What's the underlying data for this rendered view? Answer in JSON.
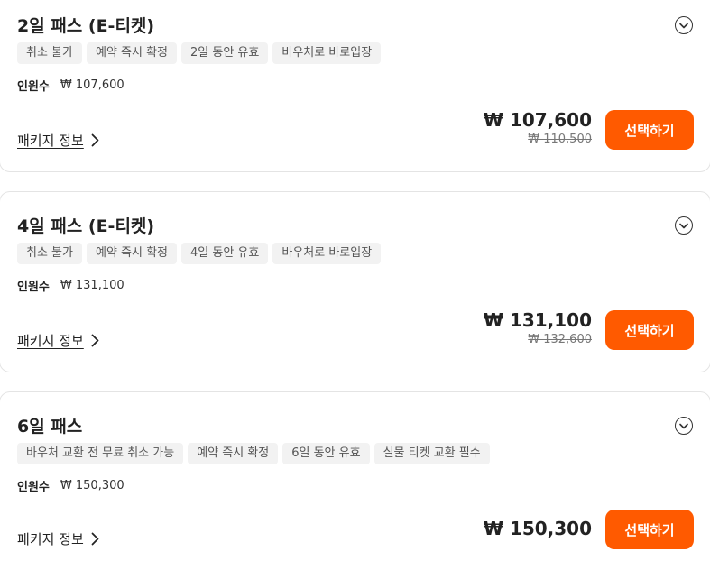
{
  "packages": [
    {
      "title": "2일 패스 (E-티켓)",
      "tags": [
        "취소 불가",
        "예약 즉시 확정",
        "2일 동안 유효",
        "바우처로 바로입장"
      ],
      "people_label": "인원수",
      "people_price": "₩ 107,600",
      "package_info_label": "패키지 정보",
      "price": "₩ 107,600",
      "original_price": "₩ 110,500",
      "select_label": "선택하기"
    },
    {
      "title": "4일 패스 (E-티켓)",
      "tags": [
        "취소 불가",
        "예약 즉시 확정",
        "4일 동안 유효",
        "바우처로 바로입장"
      ],
      "people_label": "인원수",
      "people_price": "₩ 131,100",
      "package_info_label": "패키지 정보",
      "price": "₩ 131,100",
      "original_price": "₩ 132,600",
      "select_label": "선택하기"
    },
    {
      "title": "6일 패스",
      "tags": [
        "바우처 교환 전 무료 취소 가능",
        "예약 즉시 확정",
        "6일 동안 유효",
        "실물 티켓 교환 필수"
      ],
      "people_label": "인원수",
      "people_price": "₩ 150,300",
      "package_info_label": "패키지 정보",
      "price": "₩ 150,300",
      "original_price": "",
      "select_label": "선택하기"
    }
  ],
  "colors": {
    "accent": "#ff5a00",
    "tag_bg": "#f2f2f2",
    "border": "#e4e4e4"
  },
  "icons": {
    "expand": "chevron-down-circle-icon",
    "link_arrow": "chevron-right-icon"
  }
}
